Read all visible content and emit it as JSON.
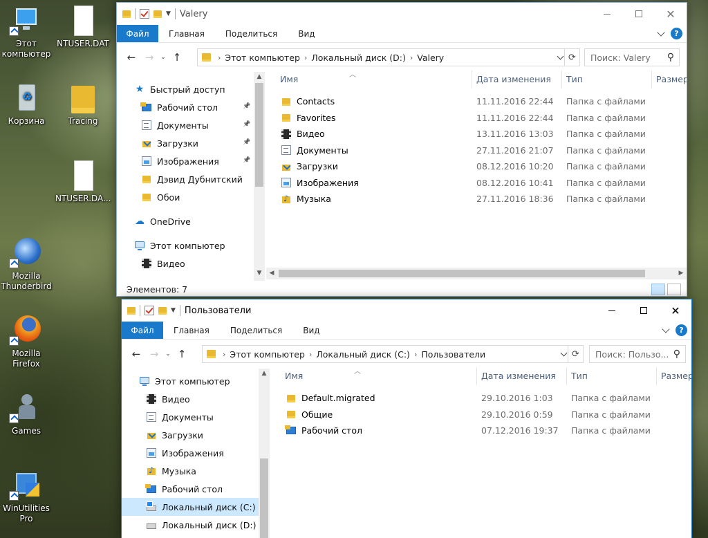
{
  "desktop": {
    "icons": [
      {
        "name": "this-pc",
        "label": "Этот компьютер",
        "icon": "computer-icon"
      },
      {
        "name": "ntuser-dat",
        "label": "NTUSER.DAT",
        "icon": "file-icon"
      },
      {
        "name": "recycle-bin",
        "label": "Корзина",
        "icon": "recycle-bin-icon"
      },
      {
        "name": "tracing",
        "label": "Tracing",
        "icon": "folder-icon"
      },
      {
        "name": "ntuser-da2",
        "label": "NTUSER.DA...",
        "icon": "file-icon"
      },
      {
        "name": "thunderbird",
        "label": "Mozilla Thunderbird",
        "icon": "thunderbird-icon"
      },
      {
        "name": "firefox",
        "label": "Mozilla Firefox",
        "icon": "firefox-icon"
      },
      {
        "name": "games",
        "label": "Games",
        "icon": "chess-pawn-icon"
      },
      {
        "name": "winutilities",
        "label": "WinUtilities Pro",
        "icon": "winutilities-icon"
      }
    ]
  },
  "win1": {
    "title": "Valery",
    "tabs": {
      "file": "Файл",
      "home": "Главная",
      "share": "Поделиться",
      "view": "Вид"
    },
    "help": "?",
    "address": {
      "parts": [
        "Этот компьютер",
        "Локальный диск (D:)",
        "Valery"
      ]
    },
    "search_placeholder": "Поиск: Valery",
    "nav": [
      {
        "label": "Быстрый доступ",
        "icon": "star",
        "pinned": false,
        "indent": 0
      },
      {
        "label": "Рабочий стол",
        "icon": "desk",
        "pinned": true,
        "indent": 1
      },
      {
        "label": "Документы",
        "icon": "doc",
        "pinned": true,
        "indent": 1
      },
      {
        "label": "Загрузки",
        "icon": "down",
        "pinned": true,
        "indent": 1
      },
      {
        "label": "Изображения",
        "icon": "img",
        "pinned": true,
        "indent": 1
      },
      {
        "label": "Дэвид Дубнитский",
        "icon": "folder",
        "pinned": false,
        "indent": 1
      },
      {
        "label": "Обои",
        "icon": "folder",
        "pinned": false,
        "indent": 1
      },
      {
        "label": "OneDrive",
        "icon": "cloud",
        "pinned": false,
        "indent": 0
      },
      {
        "label": "Этот компьютер",
        "icon": "pc",
        "pinned": false,
        "indent": 0
      },
      {
        "label": "Видео",
        "icon": "video",
        "pinned": false,
        "indent": 1
      }
    ],
    "columns": {
      "name": "Имя",
      "date": "Дата изменения",
      "type": "Тип",
      "size": "Размер"
    },
    "rows": [
      {
        "name": "Contacts",
        "icon": "folder",
        "date": "11.11.2016 22:44",
        "type": "Папка с файлами"
      },
      {
        "name": "Favorites",
        "icon": "folder",
        "date": "11.11.2016 22:44",
        "type": "Папка с файлами"
      },
      {
        "name": "Видео",
        "icon": "video",
        "date": "13.11.2016 13:03",
        "type": "Папка с файлами"
      },
      {
        "name": "Документы",
        "icon": "doc",
        "date": "27.11.2016 21:07",
        "type": "Папка с файлами"
      },
      {
        "name": "Загрузки",
        "icon": "down",
        "date": "08.12.2016 10:20",
        "type": "Папка с файлами"
      },
      {
        "name": "Изображения",
        "icon": "img",
        "date": "08.12.2016 10:41",
        "type": "Папка с файлами"
      },
      {
        "name": "Музыка",
        "icon": "music",
        "date": "27.11.2016 18:36",
        "type": "Папка с файлами"
      }
    ],
    "status": "Элементов: 7"
  },
  "win2": {
    "title": "Пользователи",
    "tabs": {
      "file": "Файл",
      "home": "Главная",
      "share": "Поделиться",
      "view": "Вид"
    },
    "help": "?",
    "address": {
      "parts": [
        "Этот компьютер",
        "Локальный диск (C:)",
        "Пользователи"
      ]
    },
    "search_placeholder": "Поиск: Пользо...",
    "nav": [
      {
        "label": "Этот компьютер",
        "icon": "pc",
        "selected": false,
        "indent": 0
      },
      {
        "label": "Видео",
        "icon": "video",
        "selected": false,
        "indent": 1
      },
      {
        "label": "Документы",
        "icon": "doc",
        "selected": false,
        "indent": 1
      },
      {
        "label": "Загрузки",
        "icon": "down",
        "selected": false,
        "indent": 1
      },
      {
        "label": "Изображения",
        "icon": "img",
        "selected": false,
        "indent": 1
      },
      {
        "label": "Музыка",
        "icon": "music",
        "selected": false,
        "indent": 1
      },
      {
        "label": "Рабочий стол",
        "icon": "desk",
        "selected": false,
        "indent": 1
      },
      {
        "label": "Локальный диск (C:)",
        "icon": "drivec",
        "selected": true,
        "indent": 1
      },
      {
        "label": "Локальный диск (D:)",
        "icon": "drive",
        "selected": false,
        "indent": 1
      }
    ],
    "columns": {
      "name": "Имя",
      "date": "Дата изменения",
      "type": "Тип",
      "size": "Размер"
    },
    "rows": [
      {
        "name": "Default.migrated",
        "icon": "folder",
        "date": "29.10.2016 1:03",
        "type": "Папка с файлами"
      },
      {
        "name": "Общие",
        "icon": "folder",
        "date": "29.10.2016 0:59",
        "type": "Папка с файлами"
      },
      {
        "name": "Рабочий стол",
        "icon": "desk",
        "date": "07.12.2016 19:37",
        "type": "Папка с файлами"
      }
    ]
  }
}
